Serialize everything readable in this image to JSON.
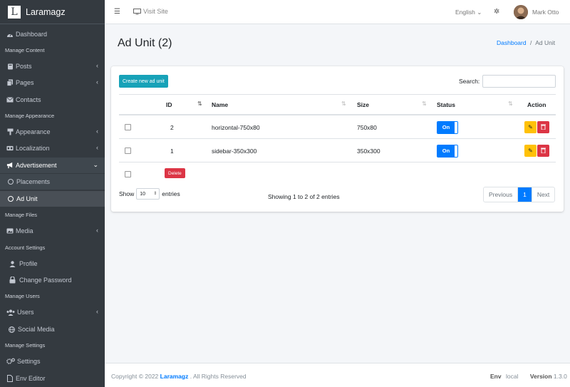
{
  "brand": {
    "letter": "L",
    "name": "Laramagz"
  },
  "sidebar": {
    "dashboard": "Dashboard",
    "h_content": "Manage Content",
    "posts": "Posts",
    "pages": "Pages",
    "contacts": "Contacts",
    "h_appearance": "Manage Appearance",
    "appearance": "Appearance",
    "localization": "Localization",
    "advertisement": "Advertisement",
    "placements": "Placements",
    "ad_unit": "Ad Unit",
    "h_files": "Manage Files",
    "media": "Media",
    "h_account": "Account Settings",
    "profile": "Profile",
    "change_password": "Change Password",
    "h_users": "Manage Users",
    "users": "Users",
    "social_media": "Social Media",
    "h_settings": "Manage Settings",
    "settings": "Settings",
    "env_editor": "Env Editor"
  },
  "topbar": {
    "visit": "Visit Site",
    "language": "English",
    "user": "Mark Otto"
  },
  "page": {
    "title": "Ad Unit (2)",
    "crumb_home": "Dashboard",
    "crumb_sep": "/",
    "crumb_current": "Ad Unit"
  },
  "toolbar": {
    "create": "Create new ad unit",
    "search_label": "Search:",
    "search_value": ""
  },
  "table": {
    "headers": {
      "id": "ID",
      "name": "Name",
      "size": "Size",
      "status": "Status",
      "action": "Action"
    },
    "rows": [
      {
        "id": "2",
        "name": "horizontal-750x80",
        "size": "750x80",
        "status": "On"
      },
      {
        "id": "1",
        "name": "sidebar-350x300",
        "size": "350x300",
        "status": "On"
      }
    ],
    "delete_label": "Delete"
  },
  "length": {
    "show": "Show",
    "value": "10",
    "entries": "entries"
  },
  "info": "Showing 1 to 2 of 2 entries",
  "pager": {
    "prev": "Previous",
    "page": "1",
    "next": "Next"
  },
  "footer": {
    "copy_prefix": "Copyright © 2022",
    "brand": "Laramagz",
    "copy_suffix": ". All Rights Reserved",
    "env_label": "Env",
    "env_value": "local",
    "version_label": "Version",
    "version_value": "1.3.0"
  },
  "colors": {
    "sidebar": "#343a40",
    "primary": "#007bff",
    "info": "#17a2b8",
    "warning": "#ffc107",
    "danger": "#dc3545"
  }
}
